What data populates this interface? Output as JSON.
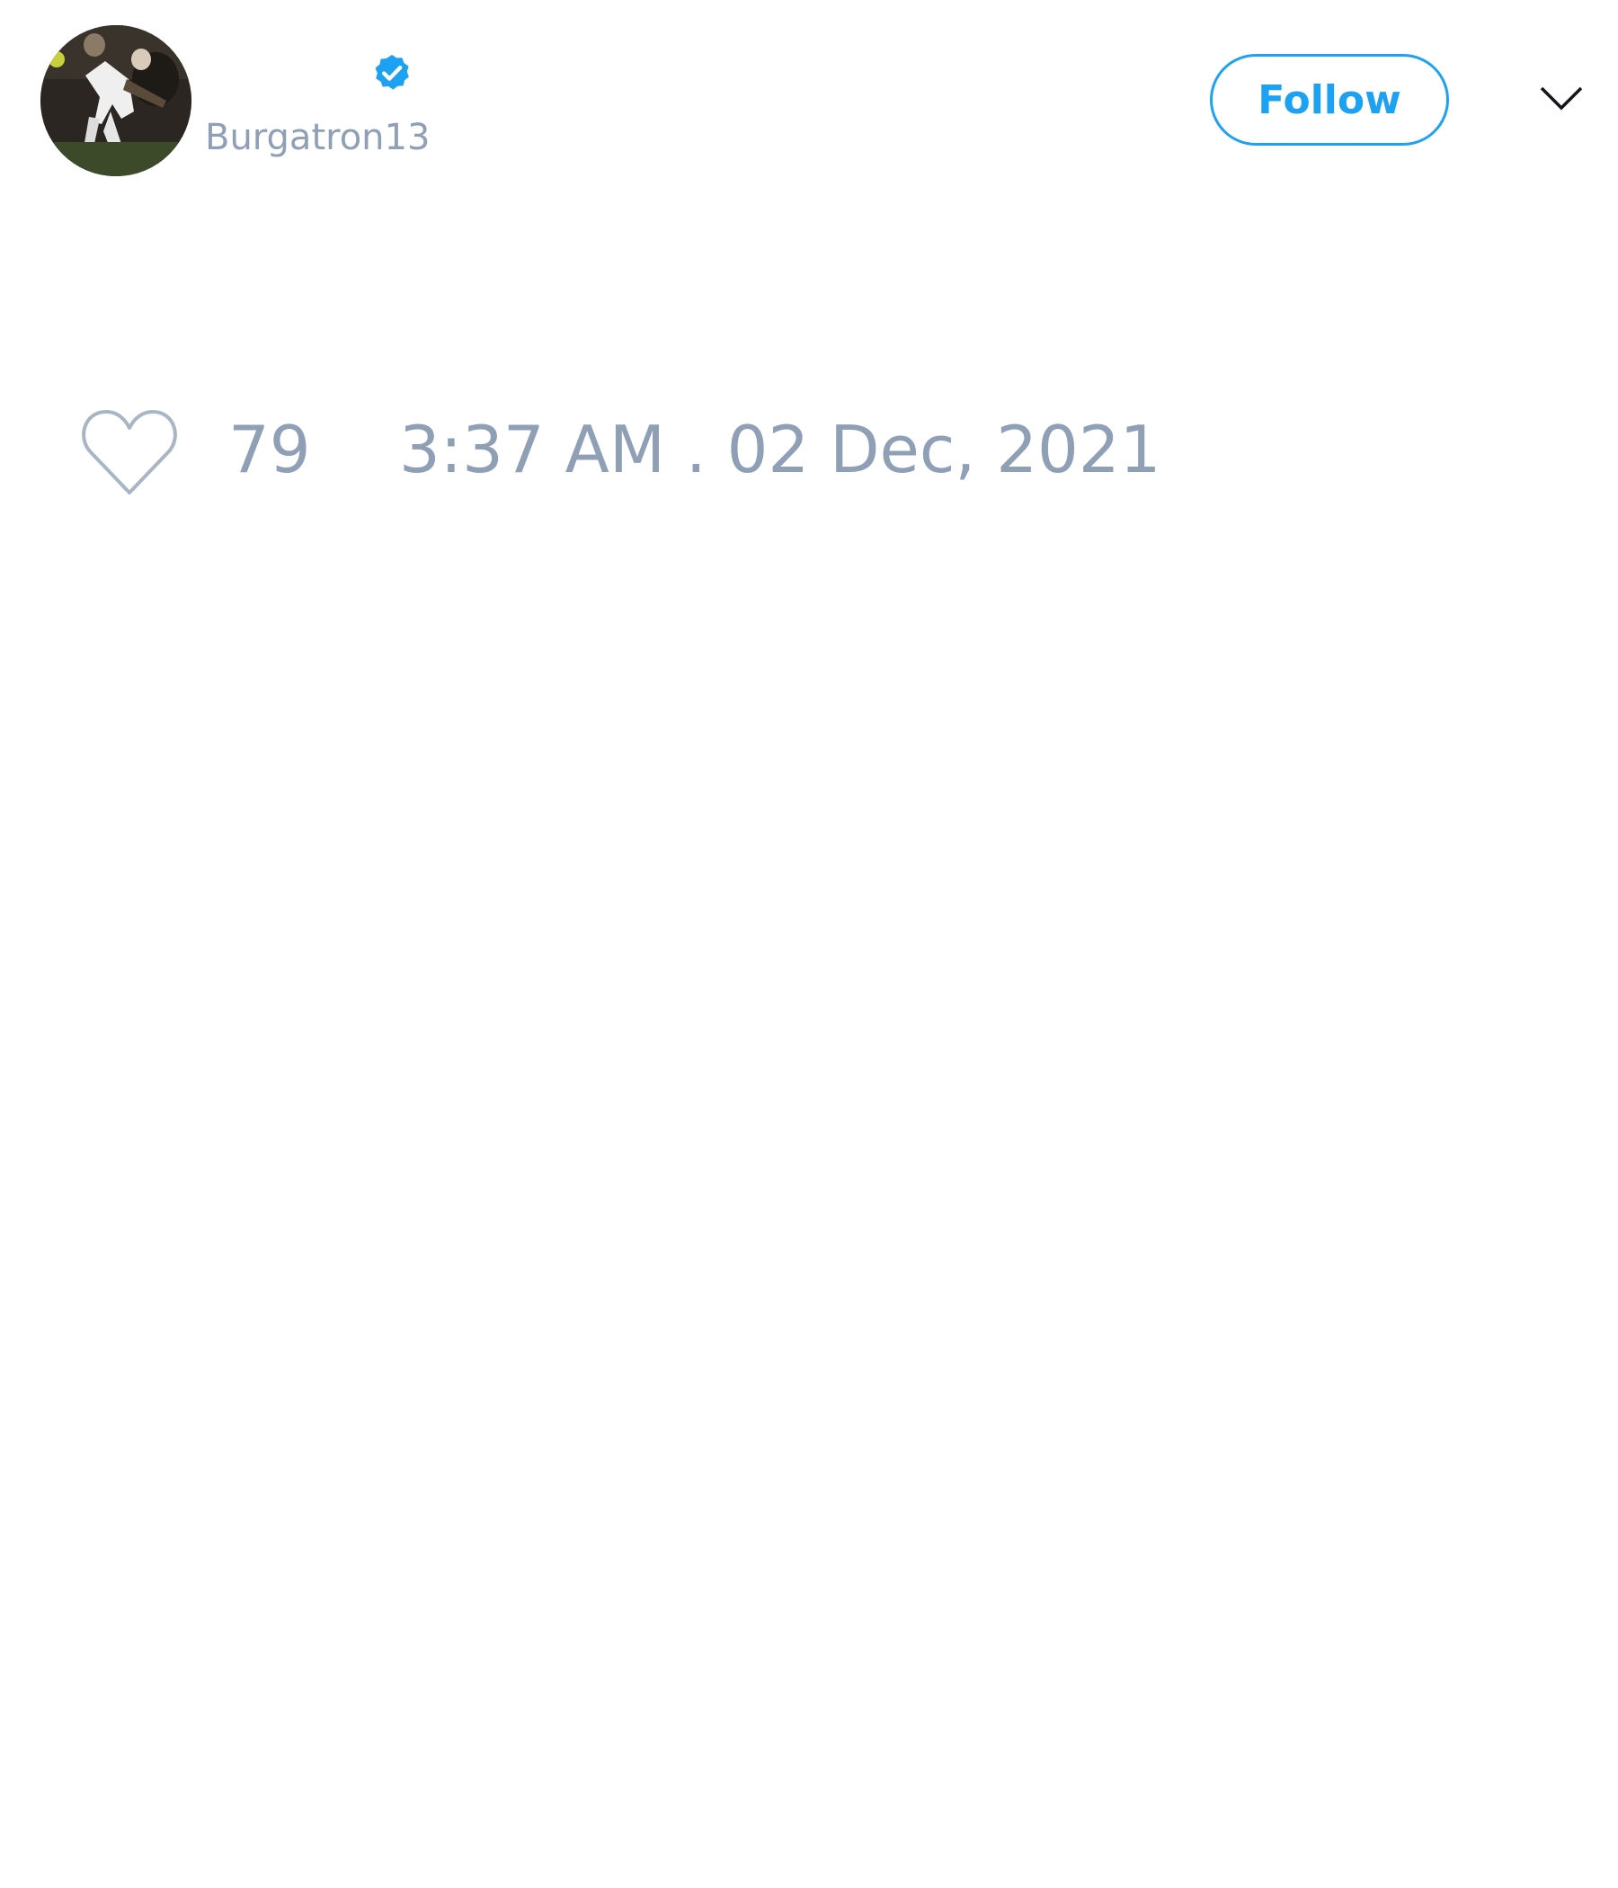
{
  "tweet": {
    "author": {
      "display_name": "",
      "handle": "Burgatron13",
      "verified": true,
      "avatar_icon": "avatar-photo"
    },
    "follow_label": "Follow",
    "menu_icon": "chevron-down-icon",
    "like_icon": "heart-icon",
    "like_count": "79",
    "timestamp": "3:37 AM . 02 Dec, 2021"
  },
  "colors": {
    "accent": "#1da1f2",
    "muted_text": "#8fa0b6",
    "background": "#ffffff"
  }
}
